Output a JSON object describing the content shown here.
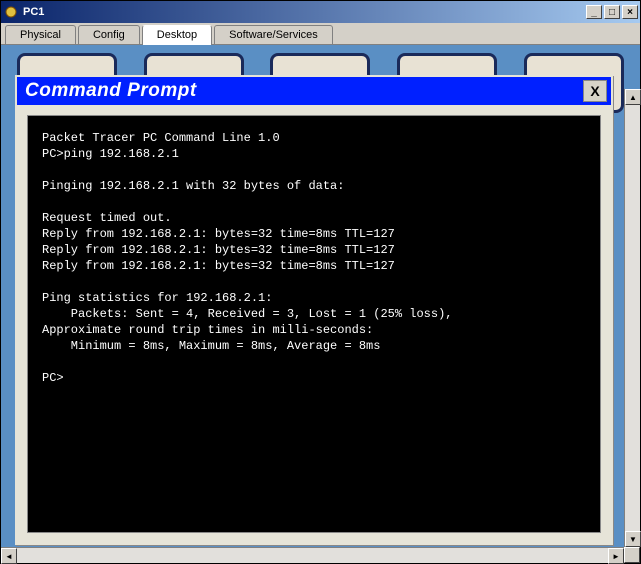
{
  "window": {
    "title": "PC1",
    "minimize": "_",
    "maximize": "□",
    "close": "×"
  },
  "tabs": {
    "physical": "Physical",
    "config": "Config",
    "desktop": "Desktop",
    "software": "Software/Services"
  },
  "cmd": {
    "title": "Command Prompt",
    "close": "X",
    "output": "Packet Tracer PC Command Line 1.0\nPC>ping 192.168.2.1\n\nPinging 192.168.2.1 with 32 bytes of data:\n\nRequest timed out.\nReply from 192.168.2.1: bytes=32 time=8ms TTL=127\nReply from 192.168.2.1: bytes=32 time=8ms TTL=127\nReply from 192.168.2.1: bytes=32 time=8ms TTL=127\n\nPing statistics for 192.168.2.1:\n    Packets: Sent = 4, Received = 3, Lost = 1 (25% loss),\nApproximate round trip times in milli-seconds:\n    Minimum = 8ms, Maximum = 8ms, Average = 8ms\n\nPC>"
  },
  "scroll": {
    "left": "◄",
    "right": "►",
    "up": "▲",
    "down": "▼"
  }
}
